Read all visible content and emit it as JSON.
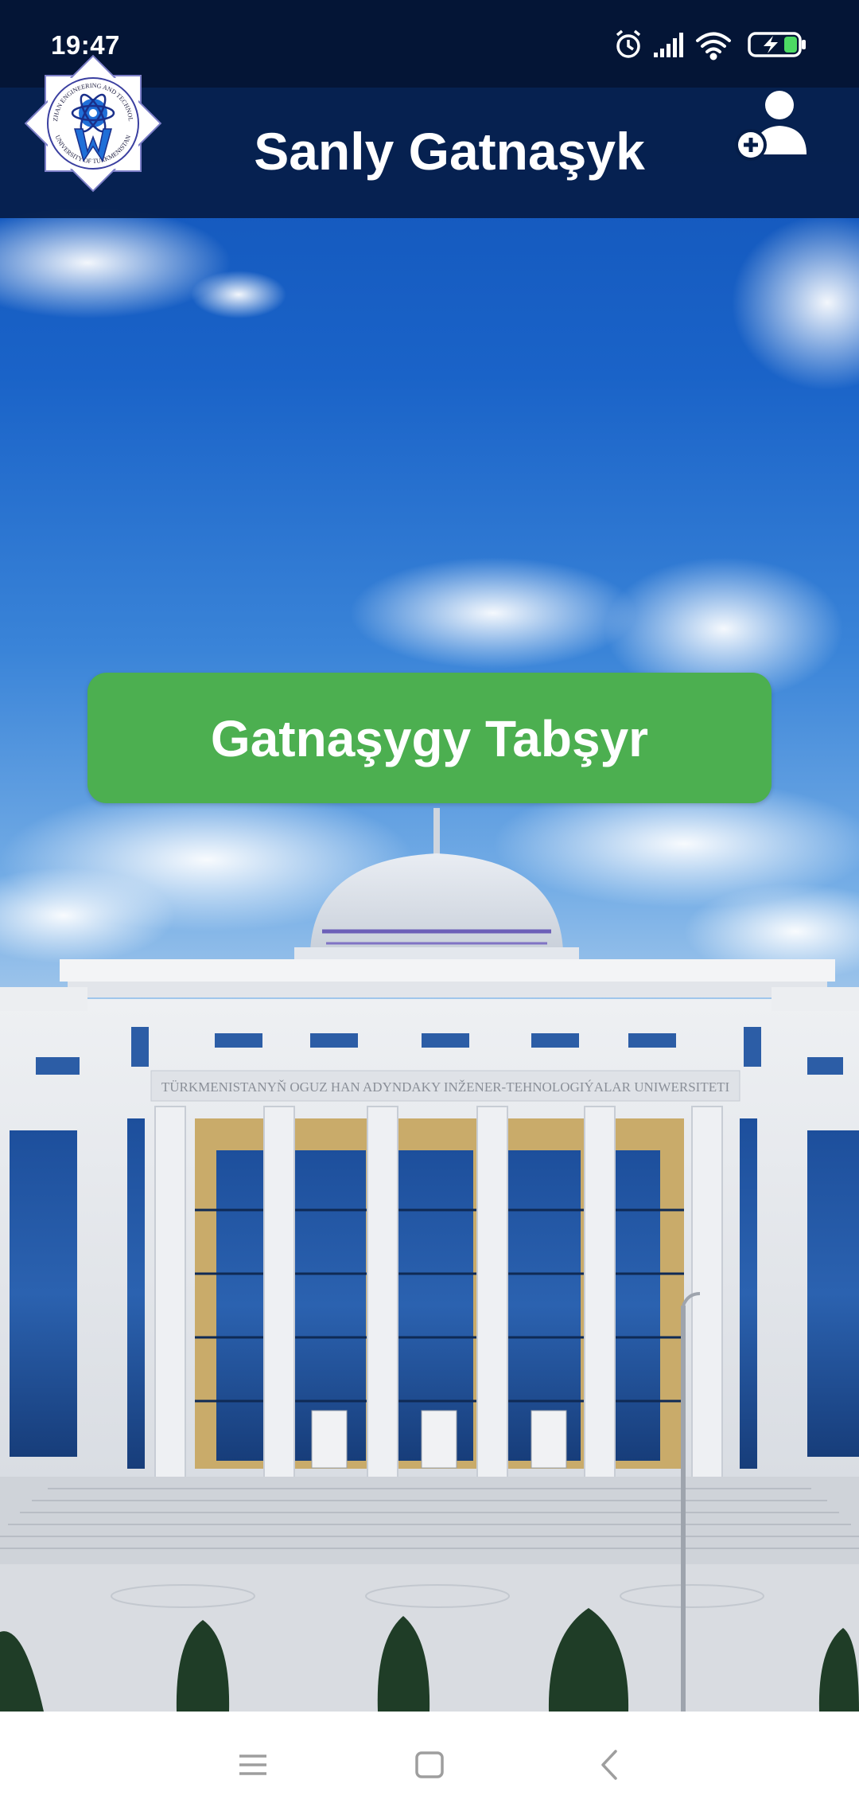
{
  "status_bar": {
    "time": "19:47",
    "icons": [
      "alarm-icon",
      "signal-icon",
      "wifi-icon",
      "battery-charging-icon"
    ]
  },
  "app_bar": {
    "title": "Sanly Gatnaşyk",
    "logo_text": "OGUZHAN ENGINEERING AND TECHNOLOGY UNIVERSITY OF TURKMENISTAN",
    "action_icon": "add-user-icon"
  },
  "main": {
    "submit_attendance_label": "Gatnaşygy Tabşyr"
  },
  "building": {
    "sign_text": "TÜRKMENISTANYŇ OGUZ HAN ADYNDAKY INŽENER-TEHNOLOGIÝALAR UNIWERSITETI"
  },
  "nav_bar": {
    "icons": [
      "menu-icon",
      "home-square-icon",
      "back-chevron-icon"
    ]
  },
  "colors": {
    "status_bar": "#041536",
    "app_bar": "#051d48",
    "button": "#4caf50",
    "button_text": "#ffffff"
  }
}
